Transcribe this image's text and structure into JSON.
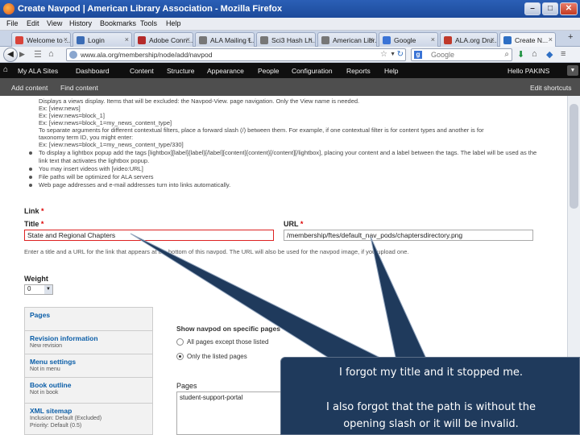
{
  "window": {
    "title": "Create Navpod | American Library Association - Mozilla Firefox",
    "controls": [
      "–",
      "□",
      "✕"
    ]
  },
  "menu": [
    "File",
    "Edit",
    "View",
    "History",
    "Bookmarks",
    "Tools",
    "Help"
  ],
  "tabs": [
    {
      "label": "Welcome to ...",
      "color": "#d9433a"
    },
    {
      "label": "Login",
      "color": "#3b6cb5"
    },
    {
      "label": "Adobe Conn...",
      "color": "#b42a2a"
    },
    {
      "label": "ALA Mailing L...",
      "color": "#777777"
    },
    {
      "label": "Sci3 Hash Lh...",
      "color": "#777777"
    },
    {
      "label": "American Libr...",
      "color": "#777777"
    },
    {
      "label": "Google",
      "color": "#3b74d6"
    },
    {
      "label": "ALA.org Dru...",
      "color": "#c0392b"
    },
    {
      "label": "Create N...",
      "color": "#2e6fc4",
      "active": true
    }
  ],
  "navbar": {
    "url": "www.ala.org/membership/node/add/navpod",
    "search_placeholder": "Google"
  },
  "admin_toolbar": {
    "items": [
      "My ALA Sites",
      "Dashboard",
      "Content",
      "Structure",
      "Appearance",
      "People",
      "Configuration",
      "Reports",
      "Help"
    ],
    "user": "Hello PAKINS",
    "toggle": "▼"
  },
  "shortcuts": {
    "add_content": "Add content",
    "find_content": "Find content",
    "edit_shortcuts": "Edit shortcuts"
  },
  "help_text": [
    "Displays a views display. Items that will be excluded: the Navpod-View. page navigation. Only the View name is needed.",
    "Ex: [view:news]",
    "Ex: [view:news=block_1]",
    "Ex: [view:news=block_1=my_news_content_type]",
    "To separate arguments for different contextual filters, place a forward slash (/) between them. For example, if one contextual filter is for content types and another is for",
    "taxonomy term ID, you might enter:",
    "Ex: [view:news=block_1=my_news_content_type/330]",
    "To display a lightbox popup add the tags [lightbox][label]{label}[/label][content]{content}[/content][/lightbox], placing your content and a label between the tags. The label will be used as the",
    "link text that activates the lightbox popup.",
    "You may insert videos with [video:URL]",
    "File paths will be optimized for ALA servers",
    "Web page addresses and e-mail addresses turn into links automatically."
  ],
  "link": {
    "section_label": "Link",
    "title_label": "Title",
    "title_value": "State and Regional Chapters",
    "url_label": "URL",
    "url_value": "/membership/ftes/default_nav_pods/chaptersdirectory.png",
    "description": "Enter a title and a URL for the link that appears at the bottom of this navpod. The URL will also be used for the navpod image, if you upload one."
  },
  "weight": {
    "label": "Weight",
    "value": "0"
  },
  "vertical_tabs": [
    {
      "title": "Pages",
      "summary": ""
    },
    {
      "title": "Revision information",
      "summary": "New revision"
    },
    {
      "title": "Menu settings",
      "summary": "Not in menu"
    },
    {
      "title": "Book outline",
      "summary": "Not in book"
    },
    {
      "title": "XML sitemap",
      "summary": "Inclusion: Default (Excluded)",
      "summary2": "Priority: Default (0.5)"
    }
  ],
  "visibility": {
    "heading": "Show navpod on specific pages",
    "options": [
      "All pages except those listed",
      "Only the listed pages"
    ],
    "selected_index": 1,
    "pages_label": "Pages",
    "pages_value": "student-support-portal"
  },
  "callout": {
    "line1": "I forgot my title and it stopped me.",
    "line2": "I also forgot that the path is without the",
    "line3": "opening slash or it will be invalid.",
    "color": "#1f3a5c"
  }
}
